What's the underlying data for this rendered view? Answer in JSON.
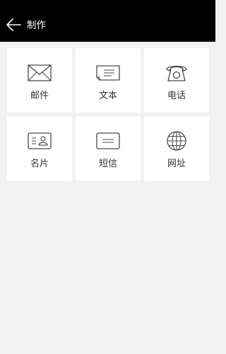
{
  "header": {
    "title": "制作",
    "back_icon": "back-arrow-icon"
  },
  "tiles": [
    {
      "label": "邮件",
      "icon": "envelope-icon"
    },
    {
      "label": "文本",
      "icon": "text-note-icon"
    },
    {
      "label": "电话",
      "icon": "telephone-icon"
    },
    {
      "label": "名片",
      "icon": "business-card-icon"
    },
    {
      "label": "短信",
      "icon": "sms-message-icon"
    },
    {
      "label": "网址",
      "icon": "globe-icon"
    }
  ],
  "colors": {
    "header_bg": "#000000",
    "page_bg": "#f2f2f2",
    "tile_bg": "#ffffff",
    "icon_stroke": "#4a4a4a",
    "label_text": "#333333"
  }
}
